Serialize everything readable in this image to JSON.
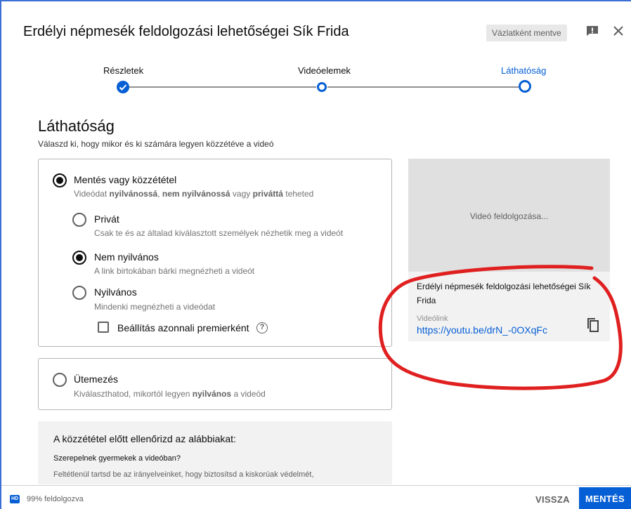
{
  "header": {
    "title": "Erdélyi népmesék feldolgozási lehetőségei Sík Frida",
    "draft_badge": "Vázlatként mentve"
  },
  "stepper": {
    "steps": [
      {
        "label": "Részletek",
        "state": "done"
      },
      {
        "label": "Videóelemek",
        "state": "pending"
      },
      {
        "label": "Láthatóság",
        "state": "current"
      }
    ]
  },
  "visibility": {
    "title": "Láthatóság",
    "subtitle": "Válaszd ki, hogy mikor és ki számára legyen közzétéve a videó",
    "save_publish": {
      "label": "Mentés vagy közzététel",
      "desc_prefix": "Videódat ",
      "desc_b1": "nyilvánossá",
      "desc_mid1": ", ",
      "desc_b2": "nem nyilvánossá",
      "desc_mid2": " vagy ",
      "desc_b3": "priváttá",
      "desc_suffix": " teheted",
      "selected": true
    },
    "options": [
      {
        "label": "Privát",
        "desc": "Csak te és az általad kiválasztott személyek nézhetik meg a videót",
        "selected": false
      },
      {
        "label": "Nem nyilvános",
        "desc": "A link birtokában bárki megnézheti a videót",
        "selected": true
      },
      {
        "label": "Nyilvános",
        "desc": "Mindenki megnézheti a videódat",
        "selected": false
      }
    ],
    "premiere_label": "Beállítás azonnali premierként",
    "schedule": {
      "label": "Ütemezés",
      "desc_prefix": "Kiválaszthatod, mikortól legyen ",
      "desc_bold": "nyilvános",
      "desc_suffix": " a videód",
      "selected": false
    }
  },
  "preview": {
    "processing": "Videó feldolgozása...",
    "title": "Erdélyi népmesék feldolgozási lehetőségei Sík Frida",
    "link_label": "Videólink",
    "link_url": "https://youtu.be/drN_-0OXqFc"
  },
  "checks": {
    "title": "A közzététel előtt ellenőrizd az alábbiakat:",
    "question": "Szerepelnek gyermekek a videóban?",
    "desc": "Feltétlenül tartsd be az irányelveinket, hogy biztosítsd a kiskorúak védelmét,"
  },
  "footer": {
    "hd_label": "HD",
    "progress_text": "99% feldolgozva",
    "back_label": "VISSZA",
    "save_label": "MENTÉS"
  },
  "colors": {
    "accent": "#065fd4",
    "annotation": "#e02020"
  }
}
